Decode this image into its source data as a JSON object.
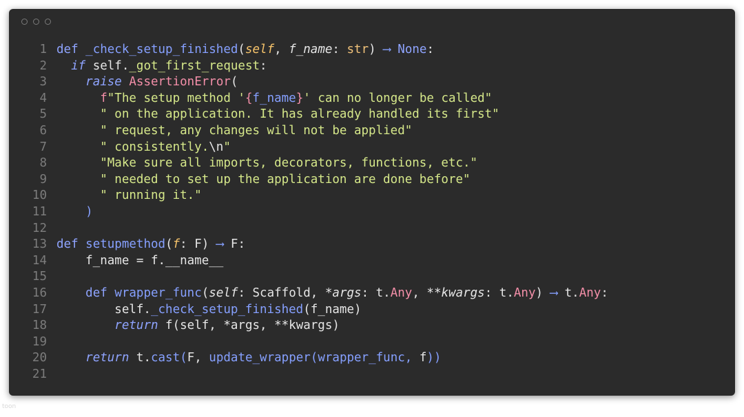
{
  "lines": [
    {
      "n": "1",
      "t": [
        [
          "kw",
          "def "
        ],
        [
          "fn",
          "_check_setup_finished"
        ],
        [
          "txt",
          "("
        ],
        [
          "prm",
          "self"
        ],
        [
          "txt",
          ", "
        ],
        [
          "ipl",
          "f_name"
        ],
        [
          "txt",
          ": "
        ],
        [
          "typ",
          "str"
        ],
        [
          "txt",
          ") "
        ],
        [
          "arr",
          "⟶"
        ],
        [
          "txt",
          " "
        ],
        [
          "kw",
          "None"
        ],
        [
          "txt",
          ":"
        ]
      ]
    },
    {
      "n": "2",
      "t": [
        [
          "txt",
          "  "
        ],
        [
          "ikw",
          "if"
        ],
        [
          "txt",
          " self."
        ],
        [
          "str",
          "_got_first_request"
        ],
        [
          "txt",
          ":"
        ]
      ]
    },
    {
      "n": "3",
      "t": [
        [
          "txt",
          "    "
        ],
        [
          "ikw",
          "raise"
        ],
        [
          "txt",
          " "
        ],
        [
          "cls",
          "AssertionError"
        ],
        [
          "txt",
          "("
        ]
      ]
    },
    {
      "n": "4",
      "t": [
        [
          "txt",
          "      "
        ],
        [
          "pnk",
          "f"
        ],
        [
          "str",
          "\"The setup method '"
        ],
        [
          "brc",
          "{"
        ],
        [
          "fn",
          "f_name"
        ],
        [
          "brc",
          "}"
        ],
        [
          "str",
          "' can no longer be called\""
        ]
      ]
    },
    {
      "n": "5",
      "t": [
        [
          "txt",
          "      "
        ],
        [
          "str",
          "\" on the application. It has already handled its first\""
        ]
      ]
    },
    {
      "n": "6",
      "t": [
        [
          "txt",
          "      "
        ],
        [
          "str",
          "\" request, any changes will not be applied\""
        ]
      ]
    },
    {
      "n": "7",
      "t": [
        [
          "txt",
          "      "
        ],
        [
          "str",
          "\" consistently."
        ],
        [
          "txt",
          "\\n"
        ],
        [
          "str",
          "\""
        ]
      ]
    },
    {
      "n": "8",
      "t": [
        [
          "txt",
          "      "
        ],
        [
          "str",
          "\"Make sure all imports, decorators, functions, etc.\""
        ]
      ]
    },
    {
      "n": "9",
      "t": [
        [
          "txt",
          "      "
        ],
        [
          "str",
          "\" needed to set up the application are done before\""
        ]
      ]
    },
    {
      "n": "10",
      "t": [
        [
          "txt",
          "      "
        ],
        [
          "str",
          "\" running it.\""
        ]
      ]
    },
    {
      "n": "11",
      "t": [
        [
          "txt",
          "    "
        ],
        [
          "fn",
          ")"
        ]
      ]
    },
    {
      "n": "12",
      "t": []
    },
    {
      "n": "13",
      "t": [
        [
          "kw",
          "def "
        ],
        [
          "fn",
          "setupmethod"
        ],
        [
          "txt",
          "("
        ],
        [
          "prm",
          "f"
        ],
        [
          "txt",
          ": F) "
        ],
        [
          "arr",
          "⟶"
        ],
        [
          "txt",
          " F:"
        ]
      ]
    },
    {
      "n": "14",
      "t": [
        [
          "txt",
          "    f_name = f.__name__"
        ]
      ]
    },
    {
      "n": "15",
      "t": []
    },
    {
      "n": "16",
      "t": [
        [
          "txt",
          "    "
        ],
        [
          "kw",
          "def "
        ],
        [
          "fn",
          "wrapper_func"
        ],
        [
          "txt",
          "("
        ],
        [
          "ipl",
          "self"
        ],
        [
          "txt",
          ": Scaffold, *"
        ],
        [
          "ipl",
          "args"
        ],
        [
          "txt",
          ": t."
        ],
        [
          "cls",
          "Any"
        ],
        [
          "txt",
          ", **"
        ],
        [
          "ipl",
          "kwargs"
        ],
        [
          "txt",
          ": t."
        ],
        [
          "cls",
          "Any"
        ],
        [
          "txt",
          ") "
        ],
        [
          "arr",
          "⟶"
        ],
        [
          "txt",
          " t."
        ],
        [
          "cls",
          "Any"
        ],
        [
          "txt",
          ":"
        ]
      ]
    },
    {
      "n": "17",
      "t": [
        [
          "txt",
          "        self."
        ],
        [
          "fn",
          "_check_setup_finished"
        ],
        [
          "txt",
          "(f_name)"
        ]
      ]
    },
    {
      "n": "18",
      "t": [
        [
          "txt",
          "        "
        ],
        [
          "ikw",
          "return"
        ],
        [
          "txt",
          " f(self, *args, **kwargs)"
        ]
      ]
    },
    {
      "n": "19",
      "t": []
    },
    {
      "n": "20",
      "t": [
        [
          "txt",
          "    "
        ],
        [
          "ikw",
          "return"
        ],
        [
          "txt",
          " t."
        ],
        [
          "fn",
          "cast"
        ],
        [
          "fn",
          "("
        ],
        [
          "txt",
          "F, "
        ],
        [
          "fn",
          "update_wrapper(wrapper_func, "
        ],
        [
          "txt",
          "f"
        ],
        [
          "fn",
          "))"
        ]
      ]
    },
    {
      "n": "21",
      "t": []
    }
  ],
  "colors": {
    "background": "#2b2b2b",
    "keyword": "#8fa4ff",
    "string": "#d6e88a",
    "parameter": "#f7c46b",
    "class": "#f48fa9",
    "line_number": "#7c7c7c"
  },
  "icons": [
    "window-dot-icon",
    "window-dot-icon",
    "window-dot-icon"
  ],
  "watermark": "toon"
}
